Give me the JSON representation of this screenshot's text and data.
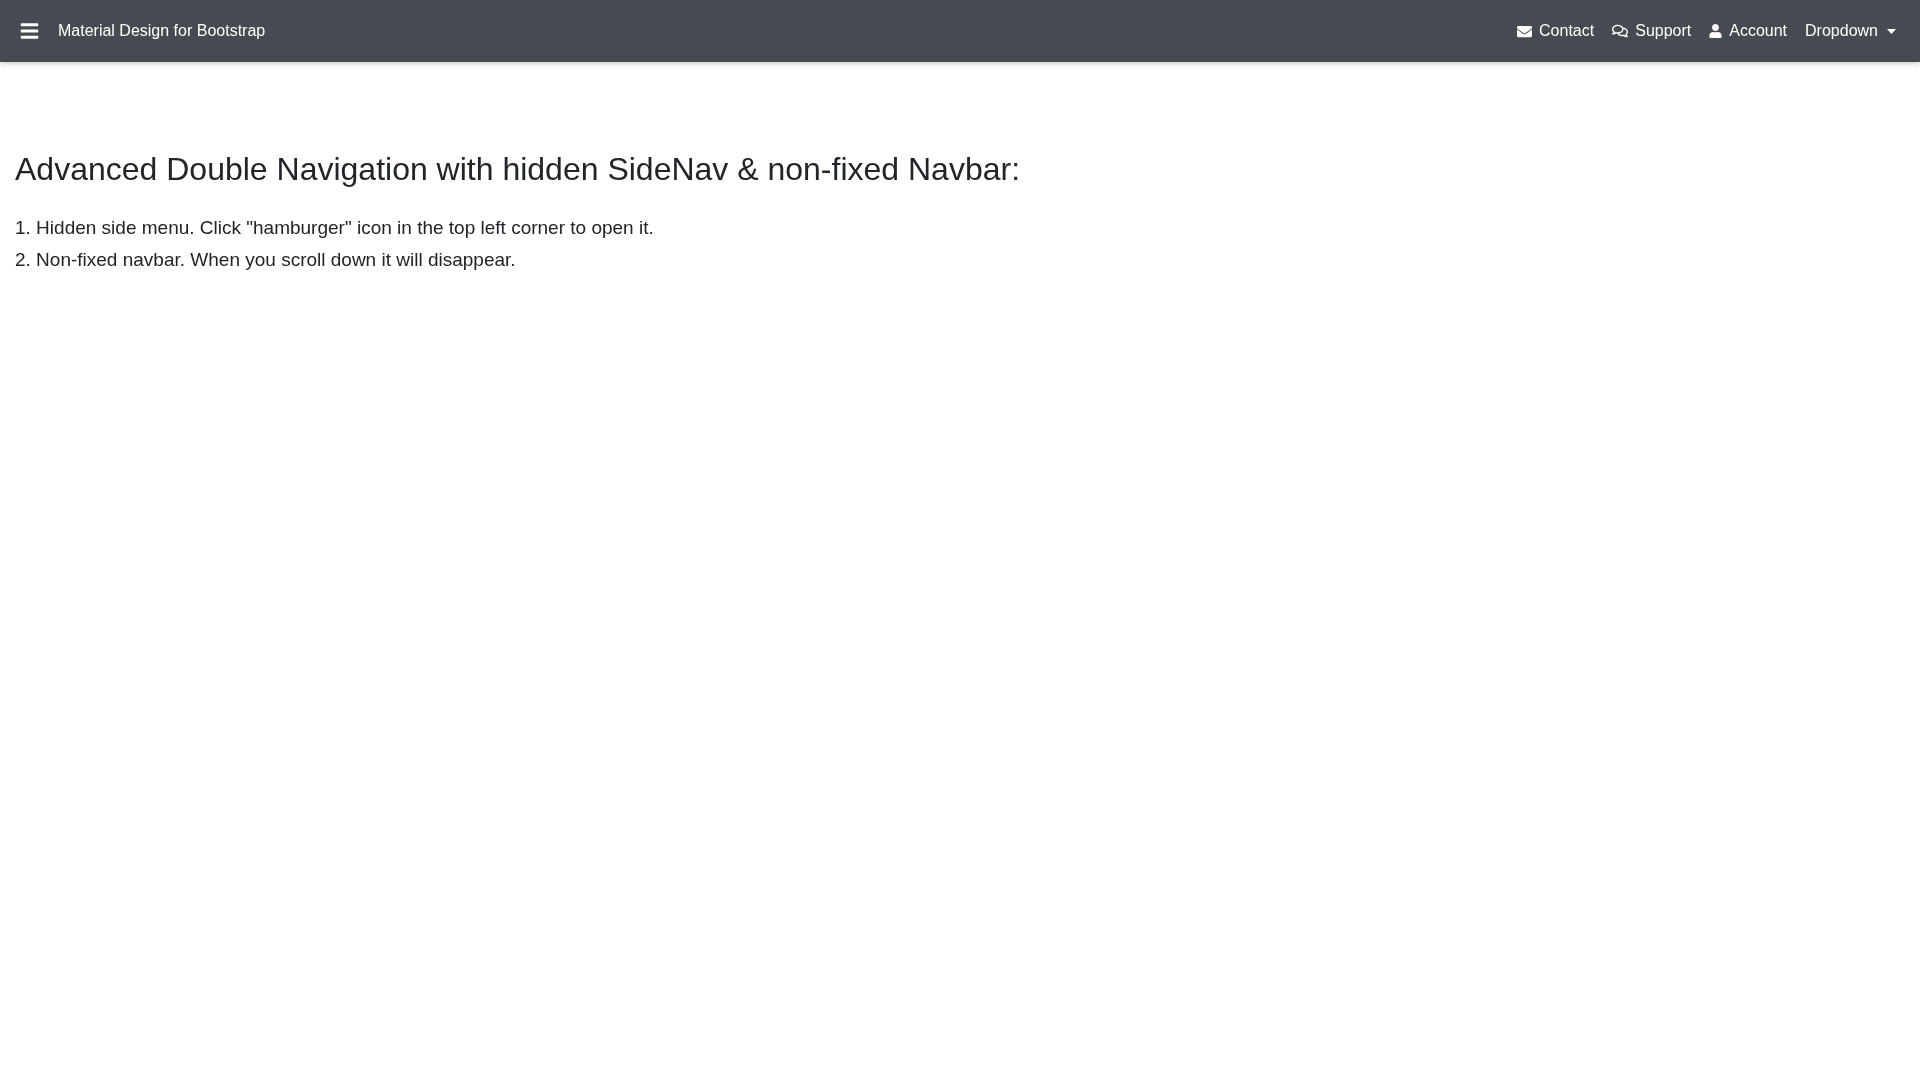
{
  "navbar": {
    "brand": "Material Design for Bootstrap",
    "links": [
      {
        "kind": "envelope",
        "label": "Contact"
      },
      {
        "kind": "comments",
        "label": "Support"
      },
      {
        "kind": "user",
        "label": "Account"
      },
      {
        "kind": "dropdown",
        "label": "Dropdown"
      }
    ]
  },
  "content": {
    "heading": "Advanced Double Navigation with hidden SideNav & non-fixed Navbar:",
    "lines": [
      "1. Hidden side menu. Click \"hamburger\" icon in the top left corner to open it.",
      "2. Non-fixed navbar. When you scroll down it will disappear."
    ]
  }
}
